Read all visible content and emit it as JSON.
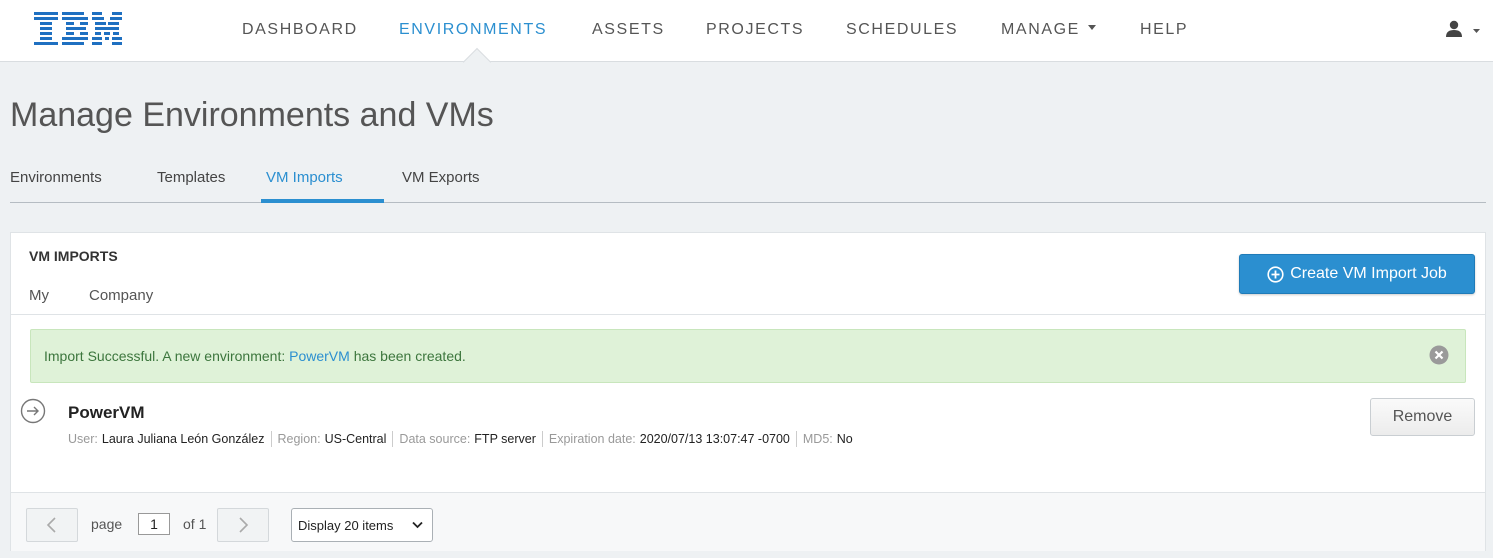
{
  "brand": {
    "logo_text": "IBM",
    "logo_color": "#1f70c1"
  },
  "nav": {
    "items": [
      {
        "label": "DASHBOARD"
      },
      {
        "label": "ENVIRONMENTS",
        "active": true
      },
      {
        "label": "ASSETS"
      },
      {
        "label": "PROJECTS"
      },
      {
        "label": "SCHEDULES"
      },
      {
        "label": "MANAGE",
        "dropdown": true
      },
      {
        "label": "HELP"
      }
    ],
    "user_icon": "user-icon"
  },
  "page": {
    "title": "Manage Environments and VMs"
  },
  "tabs": [
    {
      "label": "Environments"
    },
    {
      "label": "Templates"
    },
    {
      "label": "VM Imports",
      "active": true
    },
    {
      "label": "VM Exports"
    }
  ],
  "card": {
    "heading": "VM IMPORTS",
    "subtabs": [
      {
        "label": "My"
      },
      {
        "label": "Company"
      }
    ],
    "create_button": "Create VM Import Job",
    "alert": {
      "before": "Import Successful. A new environment: ",
      "link": "PowerVM",
      "after": " has been created."
    },
    "item": {
      "title": "PowerVM",
      "meta": {
        "user_label": "User:",
        "user": "Laura Juliana León González",
        "region_label": "Region:",
        "region": "US-Central",
        "source_label": "Data source:",
        "source": "FTP server",
        "expiration_label": "Expiration date:",
        "expiration": "2020/07/13 13:07:47 -0700",
        "md5_label": "MD5:",
        "md5": "No"
      },
      "remove_button": "Remove"
    },
    "pagination": {
      "page_label": "page",
      "page": "1",
      "of_label": "of 1",
      "display_option": "Display 20 items"
    }
  },
  "colors": {
    "accent": "#2b8fd0",
    "success_bg": "#dff2d8",
    "success_text": "#3c763d"
  }
}
